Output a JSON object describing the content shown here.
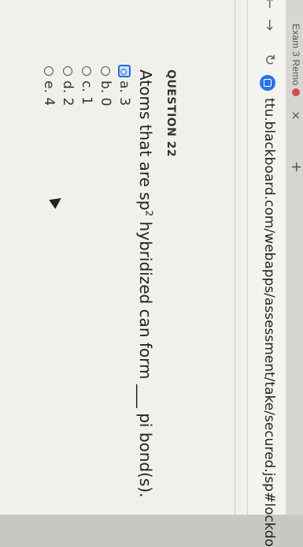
{
  "browser": {
    "tab_title": "Exam 3 Remo",
    "new_tab_symbol": "+",
    "close_symbol": "×",
    "back_symbol": "←",
    "forward_symbol": "→",
    "reload_symbol": "↻",
    "url": "ttu.blackboard.com/webapps/assessment/take/secured.jsp#lockdo"
  },
  "question": {
    "title": "QUESTION 22",
    "text_before": "Atoms that are sp",
    "superscript": "2",
    "text_after": " hybridized can form ___ pi bond(s).",
    "options": [
      {
        "label": "a. 3",
        "selected": true
      },
      {
        "label": "b. 0",
        "selected": false
      },
      {
        "label": "c. 1",
        "selected": false
      },
      {
        "label": "d. 2",
        "selected": false
      },
      {
        "label": "e. 4",
        "selected": false
      }
    ]
  },
  "colors": {
    "accent": "#1f6fd6",
    "status_dot": "#d94a55"
  }
}
